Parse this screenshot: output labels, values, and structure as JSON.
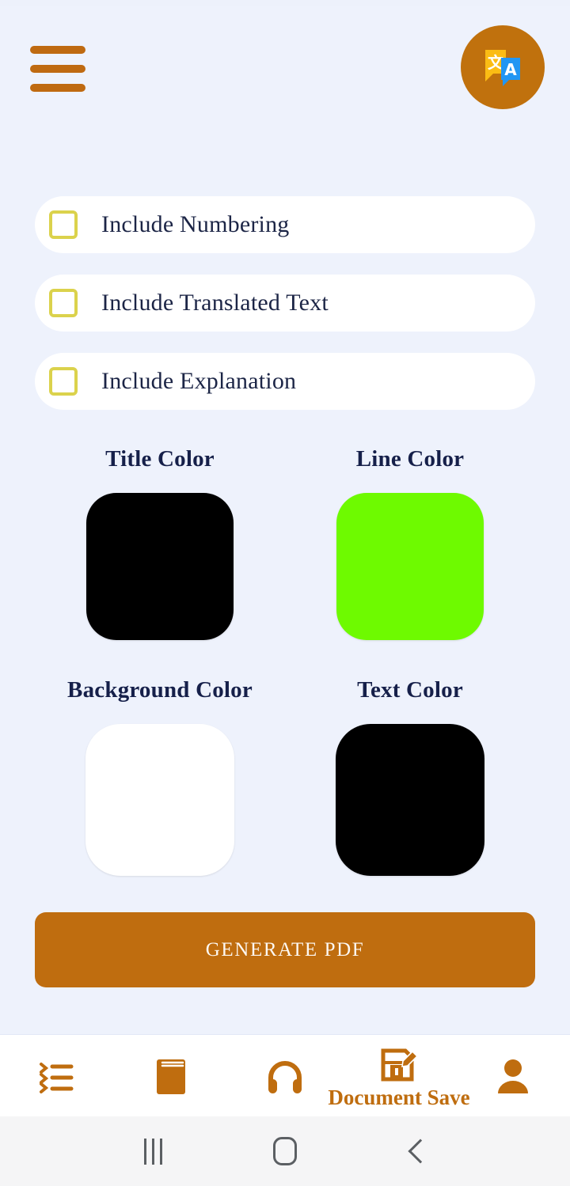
{
  "app": {
    "background_color": "#EEF2FC",
    "accent_color": "#BF6D0F",
    "checkbox_border_color": "#DBD24C",
    "text_color": "#1C2546"
  },
  "appbar": {
    "menu_icon": "hamburger-menu-icon",
    "app_badge_icon": "translate-icon"
  },
  "options": [
    {
      "label": "Include Numbering",
      "checked": false
    },
    {
      "label": "Include Translated Text",
      "checked": false
    },
    {
      "label": "Include Explanation",
      "checked": false
    }
  ],
  "color_pickers": [
    {
      "label": "Title Color",
      "value": "#000000"
    },
    {
      "label": "Line Color",
      "value": "#6EFA00"
    },
    {
      "label": "Background Color",
      "value": "#FFFFFF"
    },
    {
      "label": "Text Color",
      "value": "#000000"
    }
  ],
  "actions": {
    "generate_pdf_label": "GENERATE PDF"
  },
  "bottom_nav": {
    "items": [
      {
        "icon": "list-icon",
        "label": ""
      },
      {
        "icon": "book-icon",
        "label": ""
      },
      {
        "icon": "headphones-icon",
        "label": ""
      },
      {
        "icon": "document-save-icon",
        "label": "Document Save"
      },
      {
        "icon": "person-icon",
        "label": ""
      }
    ]
  },
  "system_nav": {
    "recents_label": "recents-icon",
    "home_label": "home-icon",
    "back_label": "back-icon"
  }
}
